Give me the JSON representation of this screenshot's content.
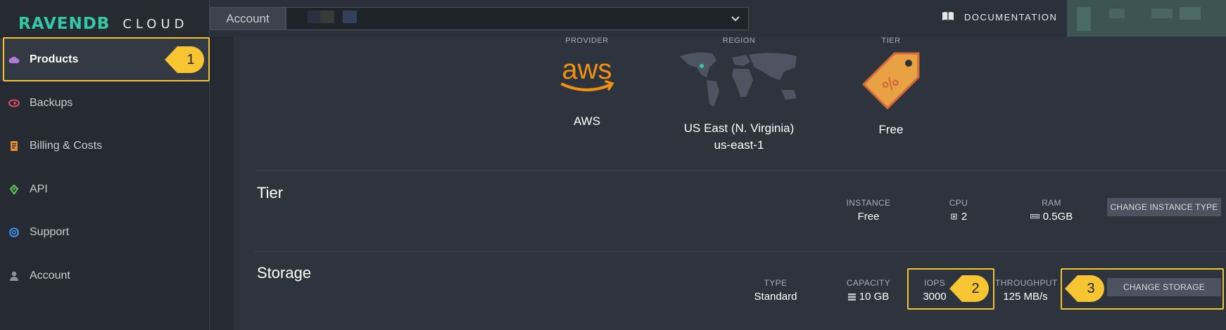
{
  "logo": {
    "brand": "RAVENDB",
    "suffix": "CLOUD"
  },
  "sidebar": {
    "items": [
      {
        "label": "Products",
        "icon": "cloud-icon",
        "active": true
      },
      {
        "label": "Backups",
        "icon": "backup-icon"
      },
      {
        "label": "Billing & Costs",
        "icon": "billing-icon"
      },
      {
        "label": "API",
        "icon": "api-icon"
      },
      {
        "label": "Support",
        "icon": "support-icon"
      },
      {
        "label": "Account",
        "icon": "user-icon"
      }
    ]
  },
  "topbar": {
    "account_label": "Account",
    "documentation_label": "DOCUMENTATION"
  },
  "overview": {
    "provider": {
      "label": "PROVIDER",
      "value": "AWS"
    },
    "region": {
      "label": "REGION",
      "value": "US East (N. Virginia)",
      "code": "us-east-1"
    },
    "tier": {
      "label": "TIER",
      "value": "Free"
    }
  },
  "tier_section": {
    "title": "Tier",
    "instance": {
      "label": "INSTANCE",
      "value": "Free"
    },
    "cpu": {
      "label": "CPU",
      "value": "2"
    },
    "ram": {
      "label": "RAM",
      "value": "0.5GB"
    },
    "button": "CHANGE INSTANCE TYPE"
  },
  "storage_section": {
    "title": "Storage",
    "type": {
      "label": "TYPE",
      "value": "Standard"
    },
    "capacity": {
      "label": "CAPACITY",
      "value": "10 GB"
    },
    "iops": {
      "label": "IOPS",
      "value": "3000"
    },
    "throughput": {
      "label": "THROUGHPUT",
      "value": "125 MB/s"
    },
    "button": "CHANGE STORAGE"
  },
  "callouts": [
    "1",
    "2",
    "3"
  ],
  "colors": {
    "accent": "#34c9a6",
    "highlight": "#f2c230",
    "aws_orange": "#f29111"
  }
}
